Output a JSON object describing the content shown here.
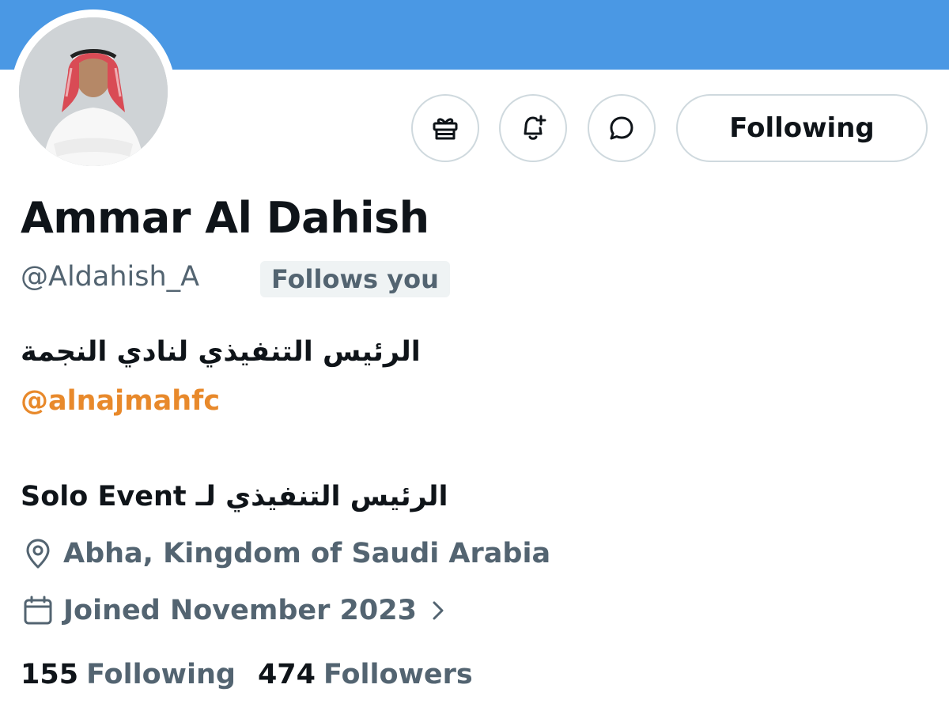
{
  "profile": {
    "display_name": "Ammar Al Dahish",
    "handle": "@Aldahish_A",
    "follows_you_badge": "Follows you",
    "follow_button_label": "Following",
    "bio": {
      "line1": "الرئيس التنفيذي لنادي النجمة",
      "mention": "@alnajmahfc",
      "line2_arabic": "الرئيس التنفيذي لـ",
      "line2_latin": "Solo Event"
    },
    "location": "Abha, Kingdom of Saudi Arabia",
    "joined": "Joined November 2023",
    "stats": {
      "following_count": "155",
      "following_label": "Following",
      "followers_count": "474",
      "followers_label": "Followers"
    }
  },
  "icons": {
    "gift": "gift-icon",
    "notify": "bell-plus-icon",
    "message": "message-bubble-icon",
    "location": "location-pin-icon",
    "calendar": "calendar-icon",
    "chevron": "chevron-right-icon"
  },
  "colors": {
    "banner": "#4a98e4",
    "mention": "#e8892b",
    "secondary_text": "#536471",
    "primary_text": "#0f1419",
    "button_border": "#cfd9de"
  }
}
